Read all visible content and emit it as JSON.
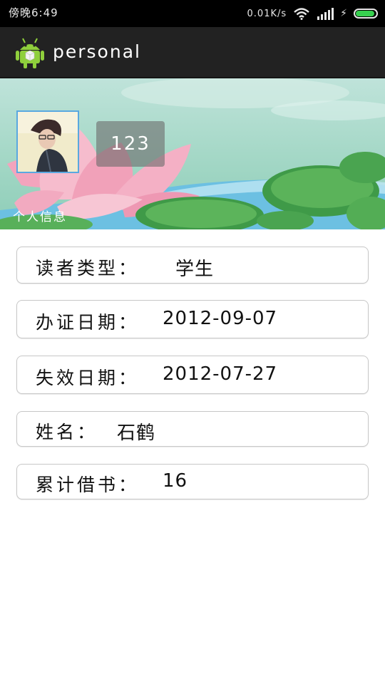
{
  "status_bar": {
    "time": "傍晚6:49",
    "net_speed": "0.01K/s",
    "battery_level": 0.85,
    "accent_color": "#37d04f"
  },
  "action_bar": {
    "app_icon": "android-icon",
    "title": "personal"
  },
  "profile": {
    "avatar": "avatar-photo",
    "name": "123",
    "caption": "个人信息"
  },
  "info_rows": [
    {
      "label": "读者类型：",
      "value": "学生"
    },
    {
      "label": "办证日期：",
      "value": "2012-09-07"
    },
    {
      "label": "失效日期：",
      "value": "2012-07-27"
    },
    {
      "label": "姓名：",
      "value": "石鹤"
    },
    {
      "label": "累计借书：",
      "value": "16"
    }
  ]
}
